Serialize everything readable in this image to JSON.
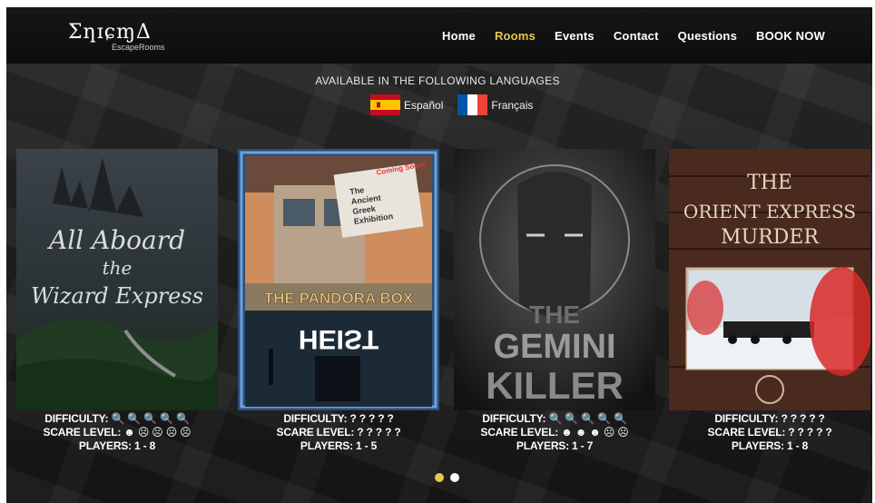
{
  "brand": {
    "logo_text": "ƩƞɪɕɱΔ",
    "logo_sub": "EscapeRooms"
  },
  "nav": {
    "items": [
      {
        "label": "Home",
        "active": false
      },
      {
        "label": "Rooms",
        "active": true
      },
      {
        "label": "Events",
        "active": false
      },
      {
        "label": "Contact",
        "active": false
      },
      {
        "label": "Questions",
        "active": false
      },
      {
        "label": "BOOK NOW",
        "active": false
      }
    ]
  },
  "languages": {
    "title": "AVAILABLE IN THE FOLLOWING LANGUAGES",
    "items": [
      {
        "label": "Español",
        "flag": "spain-flag-icon"
      },
      {
        "label": "Français",
        "flag": "france-flag-icon"
      }
    ]
  },
  "rooms": [
    {
      "poster_lines": [
        "All Aboard",
        "the",
        "Wizard Express"
      ],
      "difficulty_label": "DIFFICULTY:",
      "difficulty": "🔍 🔍 🔍 🔍 🔍",
      "scare_label": "SCARE LEVEL:",
      "scare": "☻ ☹ ☹ ☹ ☹",
      "players_label": "PLAYERS:",
      "players": "1 - 8"
    },
    {
      "poster_badge": "Coming Soon!",
      "poster_sign": [
        "The",
        "Ancient",
        "Greek",
        "Exhibition"
      ],
      "poster_lines": [
        "THE PANDORA BOX",
        "HEIST"
      ],
      "difficulty_label": "DIFFICULTY:",
      "difficulty": "? ? ? ? ?",
      "scare_label": "SCARE LEVEL:",
      "scare": "? ? ? ? ?",
      "players_label": "PLAYERS:",
      "players": "1 - 5"
    },
    {
      "poster_lines": [
        "THE",
        "GEMINI",
        "KILLER"
      ],
      "difficulty_label": "DIFFICULTY:",
      "difficulty": "🔍 🔍 🔍 🔍 🔍",
      "scare_label": "SCARE LEVEL:",
      "scare": "☻ ☻ ☻ ☹ ☹",
      "players_label": "PLAYERS:",
      "players": "1 - 7"
    },
    {
      "poster_lines": [
        "THE",
        "ORIENT EXPRESS",
        "MURDER"
      ],
      "difficulty_label": "DIFFICULTY:",
      "difficulty": "? ? ? ? ?",
      "scare_label": "SCARE LEVEL:",
      "scare": "? ? ? ? ?",
      "players_label": "PLAYERS:",
      "players": "1 - 8"
    }
  ],
  "carousel": {
    "active_page": 1,
    "pages": 2
  },
  "colors": {
    "accent": "#e6c84a",
    "nav_bg": "#111111"
  }
}
